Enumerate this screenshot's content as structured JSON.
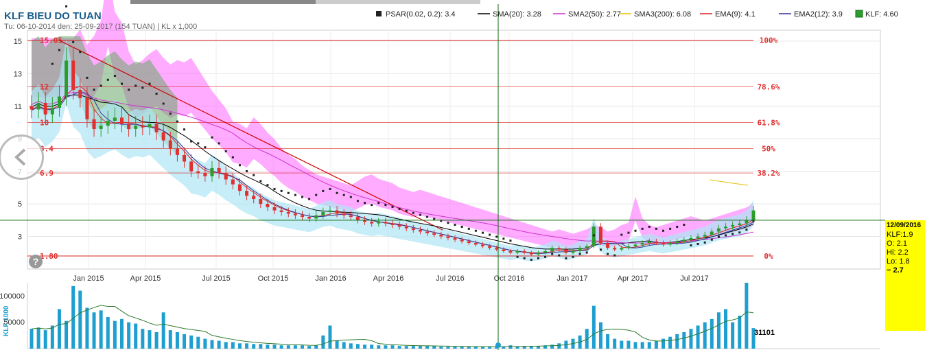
{
  "header": {
    "title": "KLF BIEU DO TUAN",
    "subtitle": "Tu: 06-10-2014 den: 25-09-2017 (154 TUAN) | KL x 1,000"
  },
  "legend": [
    {
      "label": "PSAR(0.02, 0.2): 3.4",
      "color": "#222222",
      "kind": "square"
    },
    {
      "label": "SMA(20): 3.28",
      "color": "#000000",
      "kind": "line"
    },
    {
      "label": "SMA2(50): 2.77",
      "color": "#cc33cc",
      "kind": "line"
    },
    {
      "label": "SMA3(200): 6.08",
      "color": "#e6c000",
      "kind": "line"
    },
    {
      "label": "EMA(9): 4.1",
      "color": "#dd2222",
      "kind": "line"
    },
    {
      "label": "EMA2(12): 3.9",
      "color": "#333399",
      "kind": "line"
    },
    {
      "label": "KLF: 4.60",
      "color": "#2a9d2a",
      "kind": "box"
    }
  ],
  "tooltip": {
    "date": "12/09/2016",
    "klf": "KLF:1.9",
    "open": "O: 2.1",
    "high": "Hi: 2.2",
    "low": "Lo: 1.8",
    "close": "− 2.7"
  },
  "volume_axis_label": "KLF 1000",
  "volume_last": "31101",
  "colors": {
    "up": "#2a9d2a",
    "down": "#e03030",
    "volume": "#1f9fd0",
    "cloud_bull": "#6aa86a",
    "cloud_bear": "#ff66ff",
    "band": "#aee6f5"
  },
  "chart_data": {
    "type": "candlestick",
    "ylim": [
      1.0,
      15.5
    ],
    "yticks": [
      3,
      5,
      7,
      9,
      11,
      13,
      15
    ],
    "xticks": [
      "Jan 2015",
      "Apr 2015",
      "Jul 2015",
      "Oct 2015",
      "Jan 2016",
      "Apr 2016",
      "Jul 2016",
      "Oct 2016",
      "Jan 2017",
      "Apr 2017",
      "Jul 2017"
    ],
    "fibonacci": [
      {
        "level": "100%",
        "price": 15.05,
        "price_label": "15.05"
      },
      {
        "level": "78.6%",
        "price": 12.2,
        "price_label": "12"
      },
      {
        "level": "61.8%",
        "price": 10.0,
        "price_label": "10"
      },
      {
        "level": "50%",
        "price": 8.4,
        "price_label": "8.4"
      },
      {
        "level": "38.2%",
        "price": 6.9,
        "price_label": "6.9"
      },
      {
        "level": "0%",
        "price": 1.8,
        "price_label": "1.80"
      }
    ],
    "crosshair_price": 4.0,
    "closes": [
      10.8,
      11.2,
      10.5,
      10.9,
      11.6,
      13.8,
      12.0,
      11.5,
      10.2,
      9.6,
      9.8,
      10.1,
      10.3,
      9.9,
      9.6,
      9.8,
      9.7,
      9.9,
      9.4,
      8.9,
      8.4,
      8.0,
      7.6,
      7.0,
      6.9,
      6.7,
      7.2,
      6.9,
      6.5,
      6.2,
      5.8,
      5.5,
      5.3,
      5.0,
      4.8,
      4.6,
      4.5,
      4.4,
      4.3,
      4.2,
      4.1,
      4.3,
      4.5,
      4.6,
      4.4,
      4.3,
      4.2,
      4.0,
      3.9,
      3.8,
      3.9,
      3.8,
      3.7,
      3.6,
      3.5,
      3.4,
      3.3,
      3.2,
      3.1,
      3.0,
      2.9,
      2.8,
      2.7,
      2.6,
      2.5,
      2.4,
      2.3,
      2.2,
      2.1,
      2.0,
      2.1,
      2.0,
      1.9,
      2.0,
      2.1,
      2.3,
      2.2,
      2.0,
      2.1,
      2.3,
      2.4,
      3.6,
      2.6,
      2.3,
      2.2,
      2.3,
      2.4,
      2.5,
      2.6,
      2.7,
      2.6,
      2.5,
      2.6,
      2.7,
      2.8,
      2.9,
      3.0,
      3.1,
      3.3,
      3.5,
      3.6,
      3.7,
      3.8,
      4.0,
      4.6
    ],
    "volumes": [
      30,
      32,
      28,
      35,
      60,
      42,
      95,
      88,
      62,
      55,
      58,
      48,
      42,
      45,
      40,
      38,
      30,
      28,
      25,
      55,
      28,
      25,
      22,
      20,
      18,
      15,
      13,
      12,
      10,
      10,
      8,
      8,
      7,
      7,
      6,
      6,
      5,
      5,
      5,
      5,
      4,
      5,
      20,
      35,
      12,
      10,
      8,
      7,
      6,
      6,
      5,
      5,
      5,
      4,
      4,
      4,
      4,
      4,
      4,
      3,
      3,
      3,
      3,
      3,
      3,
      3,
      3,
      3,
      3,
      5,
      3,
      4,
      4,
      4,
      5,
      6,
      8,
      12,
      15,
      20,
      30,
      65,
      40,
      22,
      15,
      12,
      12,
      10,
      10,
      10,
      12,
      15,
      18,
      22,
      25,
      30,
      35,
      40,
      45,
      55,
      60,
      40,
      50,
      100,
      31.1
    ]
  }
}
